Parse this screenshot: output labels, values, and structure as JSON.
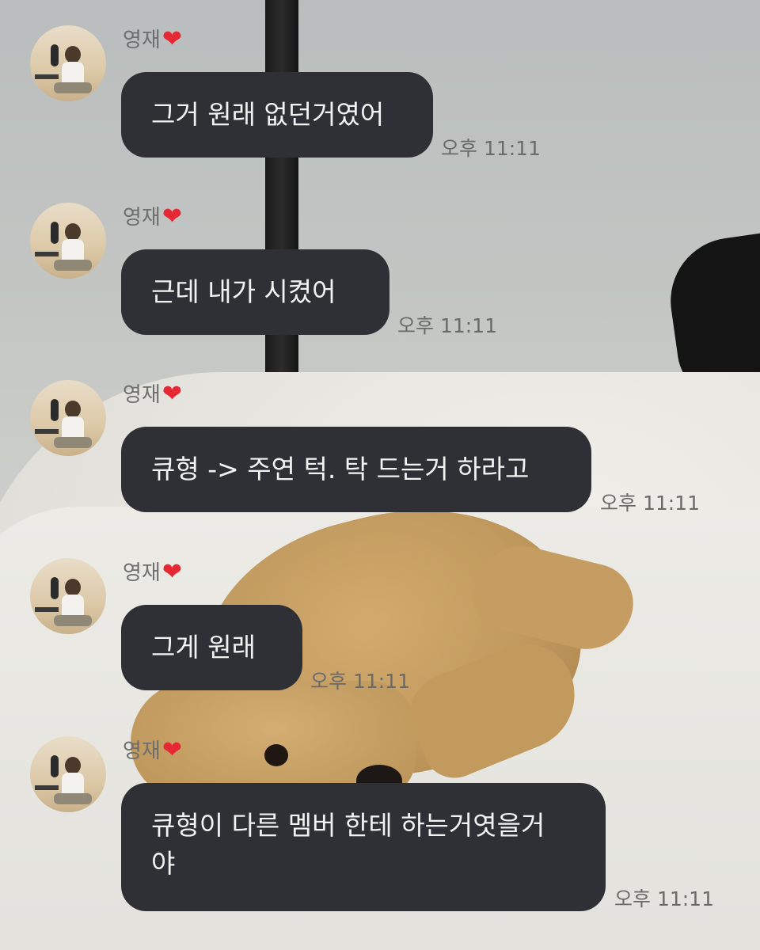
{
  "colors": {
    "bubble_bg": "#2e3035",
    "bubble_text": "#f2f2f2",
    "meta_text": "#6e6e6e",
    "heart": "#e52833"
  },
  "messages": [
    {
      "sender": "영재",
      "sender_icon": "red-heart-icon",
      "heart": "❤",
      "text": "그거 원래 없던거였어",
      "time": "오후 11:11"
    },
    {
      "sender": "영재",
      "sender_icon": "red-heart-icon",
      "heart": "❤",
      "text": "근데 내가 시켰어",
      "time": "오후 11:11"
    },
    {
      "sender": "영재",
      "sender_icon": "red-heart-icon",
      "heart": "❤",
      "text": "큐형 -> 주연 턱. 탁 드는거 하라고",
      "time": "오후 11:11"
    },
    {
      "sender": "영재",
      "sender_icon": "red-heart-icon",
      "heart": "❤",
      "text": "그게 원래",
      "time": "오후 11:11"
    },
    {
      "sender": "영재",
      "sender_icon": "red-heart-icon",
      "heart": "❤",
      "text": "큐형이 다른 멤버 한테 하는거엿을거\n야",
      "time": "오후 11:11"
    }
  ]
}
